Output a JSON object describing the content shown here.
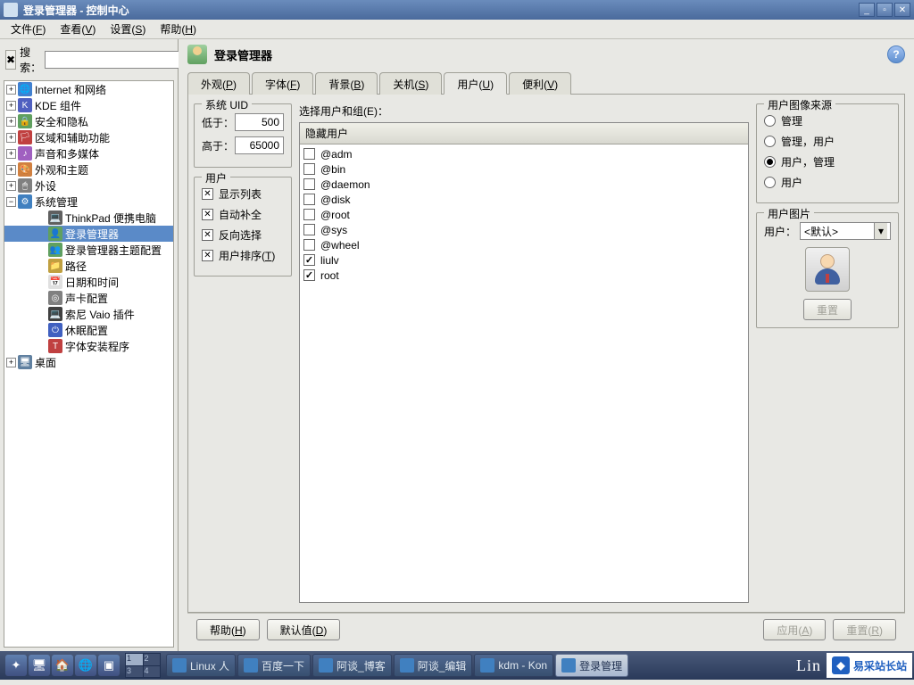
{
  "window": {
    "title": "登录管理器 - 控制中心"
  },
  "menubar": [
    {
      "label": "文件",
      "key": "F"
    },
    {
      "label": "查看",
      "key": "V"
    },
    {
      "label": "设置",
      "key": "S"
    },
    {
      "label": "帮助",
      "key": "H"
    }
  ],
  "sidebar": {
    "search_label": "搜索：",
    "tree": [
      {
        "label": "Internet 和网络",
        "expand": "+",
        "icon": "🌐",
        "bg": "#4080d0"
      },
      {
        "label": "KDE 组件",
        "expand": "+",
        "icon": "K",
        "bg": "#5060c0"
      },
      {
        "label": "安全和隐私",
        "expand": "+",
        "icon": "🔒",
        "bg": "#60a060"
      },
      {
        "label": "区域和辅助功能",
        "expand": "+",
        "icon": "🏳",
        "bg": "#c04040"
      },
      {
        "label": "声音和多媒体",
        "expand": "+",
        "icon": "♪",
        "bg": "#a060c0"
      },
      {
        "label": "外观和主题",
        "expand": "+",
        "icon": "🎨",
        "bg": "#d08040"
      },
      {
        "label": "外设",
        "expand": "+",
        "icon": "🖱",
        "bg": "#808080"
      },
      {
        "label": "系统管理",
        "expand": "−",
        "icon": "⚙",
        "bg": "#4080c0"
      }
    ],
    "sys_children": [
      {
        "label": "ThinkPad 便携电脑",
        "icon": "💻",
        "bg": "#606060"
      },
      {
        "label": "登录管理器",
        "icon": "👤",
        "bg": "#60a060",
        "selected": true
      },
      {
        "label": "登录管理器主题配置",
        "icon": "👥",
        "bg": "#60a060"
      },
      {
        "label": "路径",
        "icon": "📁",
        "bg": "#c0a040"
      },
      {
        "label": "日期和时间",
        "icon": "📅",
        "bg": "#e0e0e0"
      },
      {
        "label": "声卡配置",
        "icon": "◎",
        "bg": "#808080"
      },
      {
        "label": "索尼 Vaio 插件",
        "icon": "💻",
        "bg": "#404040"
      },
      {
        "label": "休眠配置",
        "icon": "⏻",
        "bg": "#4060c0"
      },
      {
        "label": "字体安装程序",
        "icon": "T",
        "bg": "#c04040"
      }
    ],
    "after_sys": [
      {
        "label": "桌面",
        "expand": "+",
        "icon": "🖥",
        "bg": "#6080a0"
      }
    ]
  },
  "main": {
    "header_title": "登录管理器",
    "tabs": [
      {
        "label": "外观",
        "key": "P"
      },
      {
        "label": "字体",
        "key": "F"
      },
      {
        "label": "背景",
        "key": "B"
      },
      {
        "label": "关机",
        "key": "S"
      },
      {
        "label": "用户",
        "key": "U",
        "active": true
      },
      {
        "label": "便利",
        "key": "V"
      }
    ],
    "uid_group": {
      "title": "系统 UID",
      "low_label": "低于：",
      "low_value": "500",
      "high_label": "高于：",
      "high_value": "65000"
    },
    "user_group": {
      "title": "用户",
      "opts": [
        {
          "label": "显示列表",
          "checked": true
        },
        {
          "label": "自动补全",
          "checked": true
        },
        {
          "label": "反向选择",
          "checked": true
        },
        {
          "label": "用户排序",
          "key": "T",
          "checked": true
        }
      ]
    },
    "select_label": "选择用户和组(E)：",
    "list_header": "隐藏用户",
    "users": [
      {
        "name": "@adm",
        "checked": false
      },
      {
        "name": "@bin",
        "checked": false
      },
      {
        "name": "@daemon",
        "checked": false
      },
      {
        "name": "@disk",
        "checked": false
      },
      {
        "name": "@root",
        "checked": false
      },
      {
        "name": "@sys",
        "checked": false
      },
      {
        "name": "@wheel",
        "checked": false
      },
      {
        "name": "liulv",
        "checked": true
      },
      {
        "name": "root",
        "checked": true
      }
    ],
    "img_source": {
      "title": "用户图像来源",
      "opts": [
        {
          "label": "管理",
          "selected": false
        },
        {
          "label": "管理，用户",
          "selected": false
        },
        {
          "label": "用户，管理",
          "selected": true
        },
        {
          "label": "用户",
          "selected": false
        }
      ]
    },
    "user_image": {
      "title": "用户图片",
      "user_label": "用户：",
      "user_value": "<默认>",
      "reset_btn": "重置"
    },
    "bottom": {
      "help": "帮助",
      "help_key": "H",
      "default": "默认值",
      "default_key": "D",
      "apply": "应用",
      "apply_key": "A",
      "reset": "重置",
      "reset_key": "R"
    }
  },
  "taskbar": {
    "pager": [
      "1",
      "2",
      "3",
      "4"
    ],
    "items": [
      {
        "label": "Linux 人",
        "active": false
      },
      {
        "label": "百度一下",
        "active": false
      },
      {
        "label": "阿谈_博客",
        "active": false
      },
      {
        "label": "阿谈_编辑",
        "active": false
      },
      {
        "label": "kdm - Kon",
        "active": false
      },
      {
        "label": "登录管理",
        "active": true
      }
    ],
    "tray_logo": "Lin",
    "watermark": "易采站长站"
  }
}
